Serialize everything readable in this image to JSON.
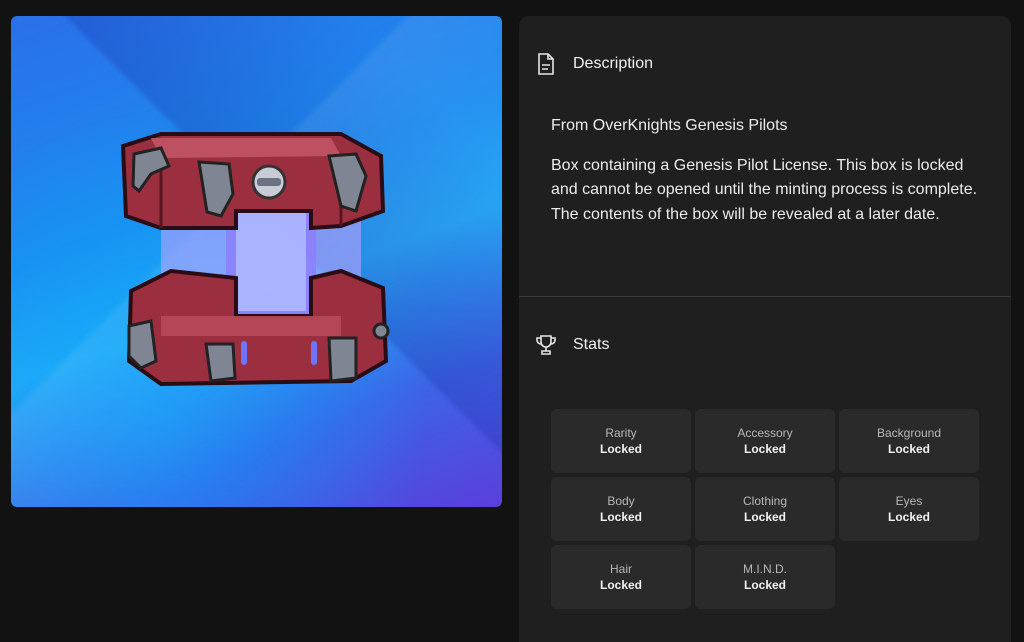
{
  "artwork": {
    "icon": "locked-chest-icon",
    "background_colors": [
      "#2a6fe8",
      "#27a8f5",
      "#5a3fdc"
    ]
  },
  "description": {
    "title": "Description",
    "icon": "document-icon",
    "collection_line": "From OverKnights Genesis Pilots",
    "body": "Box containing a Genesis Pilot License. This box is locked and cannot be opened until the minting process is complete. The contents of the box will be revealed at a later date."
  },
  "stats": {
    "title": "Stats",
    "icon": "trophy-icon",
    "items": [
      {
        "label": "Rarity",
        "value": "Locked"
      },
      {
        "label": "Accessory",
        "value": "Locked"
      },
      {
        "label": "Background",
        "value": "Locked"
      },
      {
        "label": "Body",
        "value": "Locked"
      },
      {
        "label": "Clothing",
        "value": "Locked"
      },
      {
        "label": "Eyes",
        "value": "Locked"
      },
      {
        "label": "Hair",
        "value": "Locked"
      },
      {
        "label": "M.I.N.D.",
        "value": "Locked"
      }
    ]
  }
}
